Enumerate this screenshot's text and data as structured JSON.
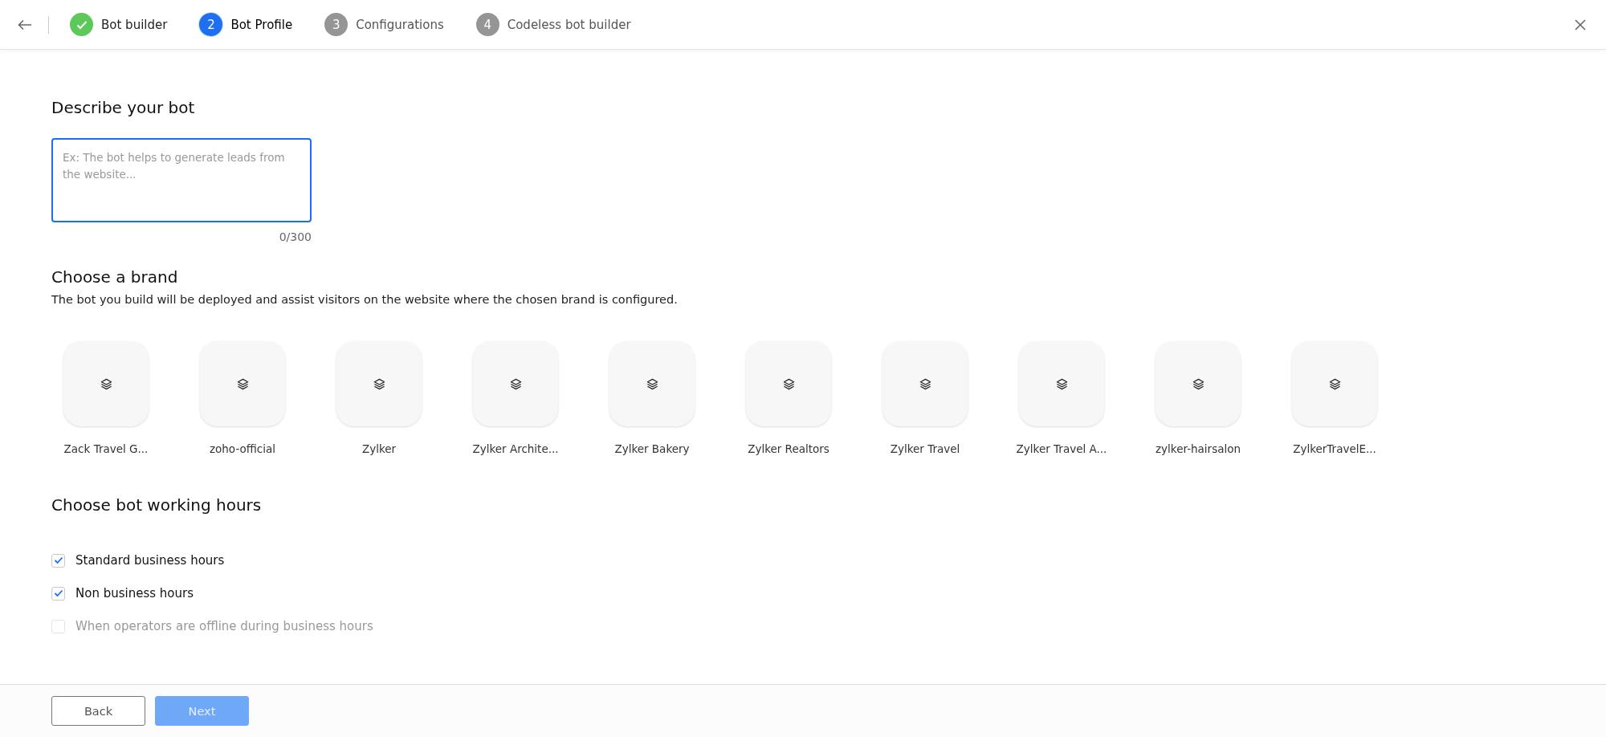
{
  "steps": [
    {
      "label": "Bot builder",
      "completed": true,
      "selected": false
    },
    {
      "number": "2",
      "label": "Bot Profile",
      "completed": false,
      "selected": true
    },
    {
      "number": "3",
      "label": "Configurations",
      "completed": false,
      "selected": false
    },
    {
      "number": "4",
      "label": "Codeless bot builder",
      "completed": false,
      "selected": false
    }
  ],
  "describe": {
    "title": "Describe your bot",
    "placeholder": "Ex: The bot helps to generate leads from the website...",
    "counter": "0/300"
  },
  "brand": {
    "title": "Choose a brand",
    "description": "The bot you build will be deployed and assist visitors on the website where the chosen brand is configured.",
    "brands": [
      {
        "name": "Zack Travel G..."
      },
      {
        "name": "zoho-official"
      },
      {
        "name": "Zylker"
      },
      {
        "name": "Zylker Archite..."
      },
      {
        "name": "Zylker Bakery"
      },
      {
        "name": "Zylker Realtors"
      },
      {
        "name": "Zylker Travel"
      },
      {
        "name": "Zylker Travel A..."
      },
      {
        "name": "zylker-hairsalon"
      },
      {
        "name": "ZylkerTravelE..."
      }
    ]
  },
  "hours": {
    "title": "Choose bot working hours",
    "options": [
      {
        "label": "Standard business hours",
        "checked": true,
        "disabled": false
      },
      {
        "label": "Non business hours",
        "checked": true,
        "disabled": false
      },
      {
        "label": "When operators are offline during business hours",
        "checked": false,
        "disabled": true
      }
    ]
  },
  "footer": {
    "back": "Back",
    "next": {
      "label": "Next",
      "disabled": true
    }
  }
}
